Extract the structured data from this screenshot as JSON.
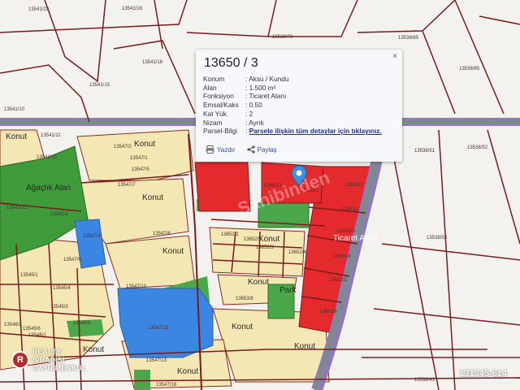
{
  "popup": {
    "title": "13650 / 3",
    "close_label": "×",
    "rows": [
      {
        "key": "Konum",
        "value": ": Aksu / Kundu"
      },
      {
        "key": "Alan",
        "value": ": 1.500 m²"
      },
      {
        "key": "Fonksiyon",
        "value": ": Ticaret Alanı"
      },
      {
        "key": "Emsal/Kaks",
        "value": ": 0.50"
      },
      {
        "key": "Kat Yük.",
        "value": ": 2"
      },
      {
        "key": "Nizam",
        "value": ": Ayrık"
      },
      {
        "key": "Parsel-Bilgi",
        "value": ": "
      }
    ],
    "detail_link": "Parsele ilişkin tüm detaylar için tıklayınız.",
    "print_label": "Yazdır",
    "share_label": "Paylaş"
  },
  "zones": {
    "konut": "Konut",
    "agaclik": "Ağaçlık Alan",
    "ticaret": "Ticaret Alanı",
    "park": "Park"
  },
  "parcels": [
    "13541/23",
    "13541/18",
    "13538/73",
    "13538/65",
    "13538/85",
    "13541/16",
    "13541/15",
    "13541/10",
    "13541/12",
    "13541/11",
    "13541/13",
    "13541/3",
    "13547/2",
    "13547/1",
    "13547/4",
    "13547/5",
    "13547/6",
    "13547/7",
    "13547/8",
    "13547/10",
    "13547/13",
    "13547/18",
    "13547/19",
    "13650/1",
    "13650/3",
    "13651/1",
    "13651/2",
    "13651/3",
    "13651/4",
    "13651/5",
    "13651/6",
    "13652/1",
    "13652/2",
    "13652/3",
    "13652/4",
    "13653/8",
    "13545/1",
    "13545/3",
    "13545/4",
    "13545/5",
    "13545/6",
    "13546/1",
    "13546/2",
    "13538/51",
    "13538/52",
    "13538/53",
    "13538/43"
  ],
  "branding": {
    "logo_letter": "R",
    "logo_line1": "REALTY",
    "logo_line2": "SIRADIŞI",
    "logo_line3": "GAYRİMENKUL",
    "listing_id": "131345-614",
    "faint_watermark": "Sahibinden"
  },
  "colors": {
    "konut": "#f3e7b4",
    "ticaret": "#e52a2e",
    "agaclik": "#3f9a3a",
    "park": "#4ba84a",
    "water": "#3b86e3",
    "road": "#8e7ab5",
    "parcel_line": "#7a1b1b"
  }
}
